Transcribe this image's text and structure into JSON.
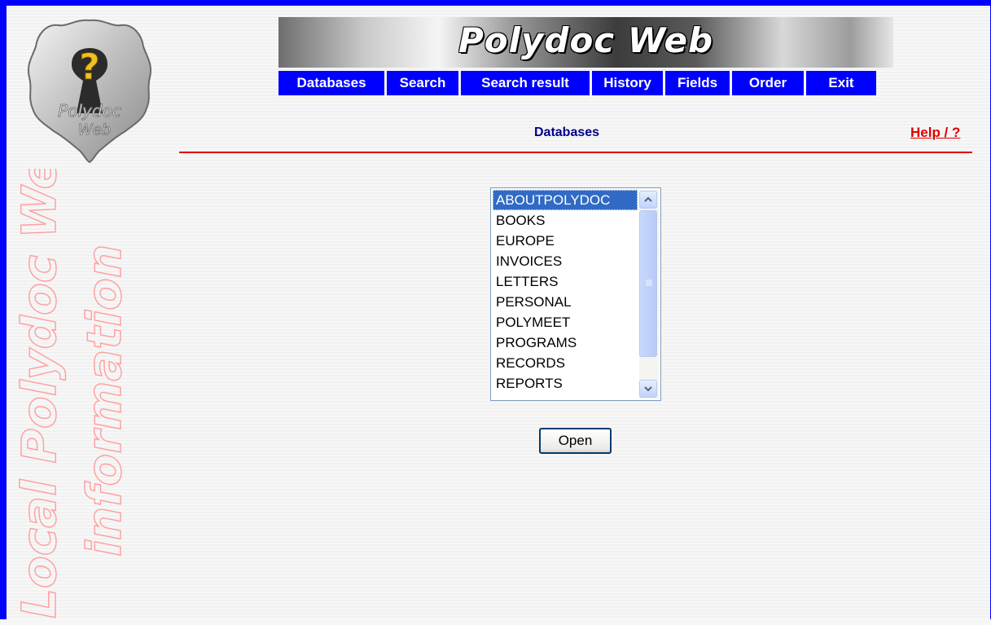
{
  "app": {
    "banner_title": "Polydoc Web",
    "logo_text": [
      "Polydoc",
      "Web"
    ],
    "side_text": [
      "Local Polydoc Web",
      "information"
    ]
  },
  "nav": {
    "items": [
      {
        "label": "Databases"
      },
      {
        "label": "Search"
      },
      {
        "label": "Search result"
      },
      {
        "label": "History"
      },
      {
        "label": "Fields"
      },
      {
        "label": "Order"
      },
      {
        "label": "Exit"
      }
    ]
  },
  "page": {
    "title": "Databases",
    "help_label": "Help / ?"
  },
  "database_list": {
    "selected": "ABOUTPOLYDOC",
    "items": [
      "ABOUTPOLYDOC",
      "BOOKS",
      "EUROPE",
      "INVOICES",
      "LETTERS",
      "PERSONAL",
      "POLYMEET",
      "PROGRAMS",
      "RECORDS",
      "REPORTS"
    ]
  },
  "actions": {
    "open_label": "Open"
  },
  "colors": {
    "frame_border": "#0000ff",
    "nav_background": "#0000ff",
    "rule": "#e00000",
    "help_link": "#e00000",
    "title": "#00008b",
    "selection": "#316ac5"
  },
  "icons": {
    "logo": "question-keyhole-seal-icon",
    "scroll_up": "chevron-up-icon",
    "scroll_down": "chevron-down-icon"
  }
}
